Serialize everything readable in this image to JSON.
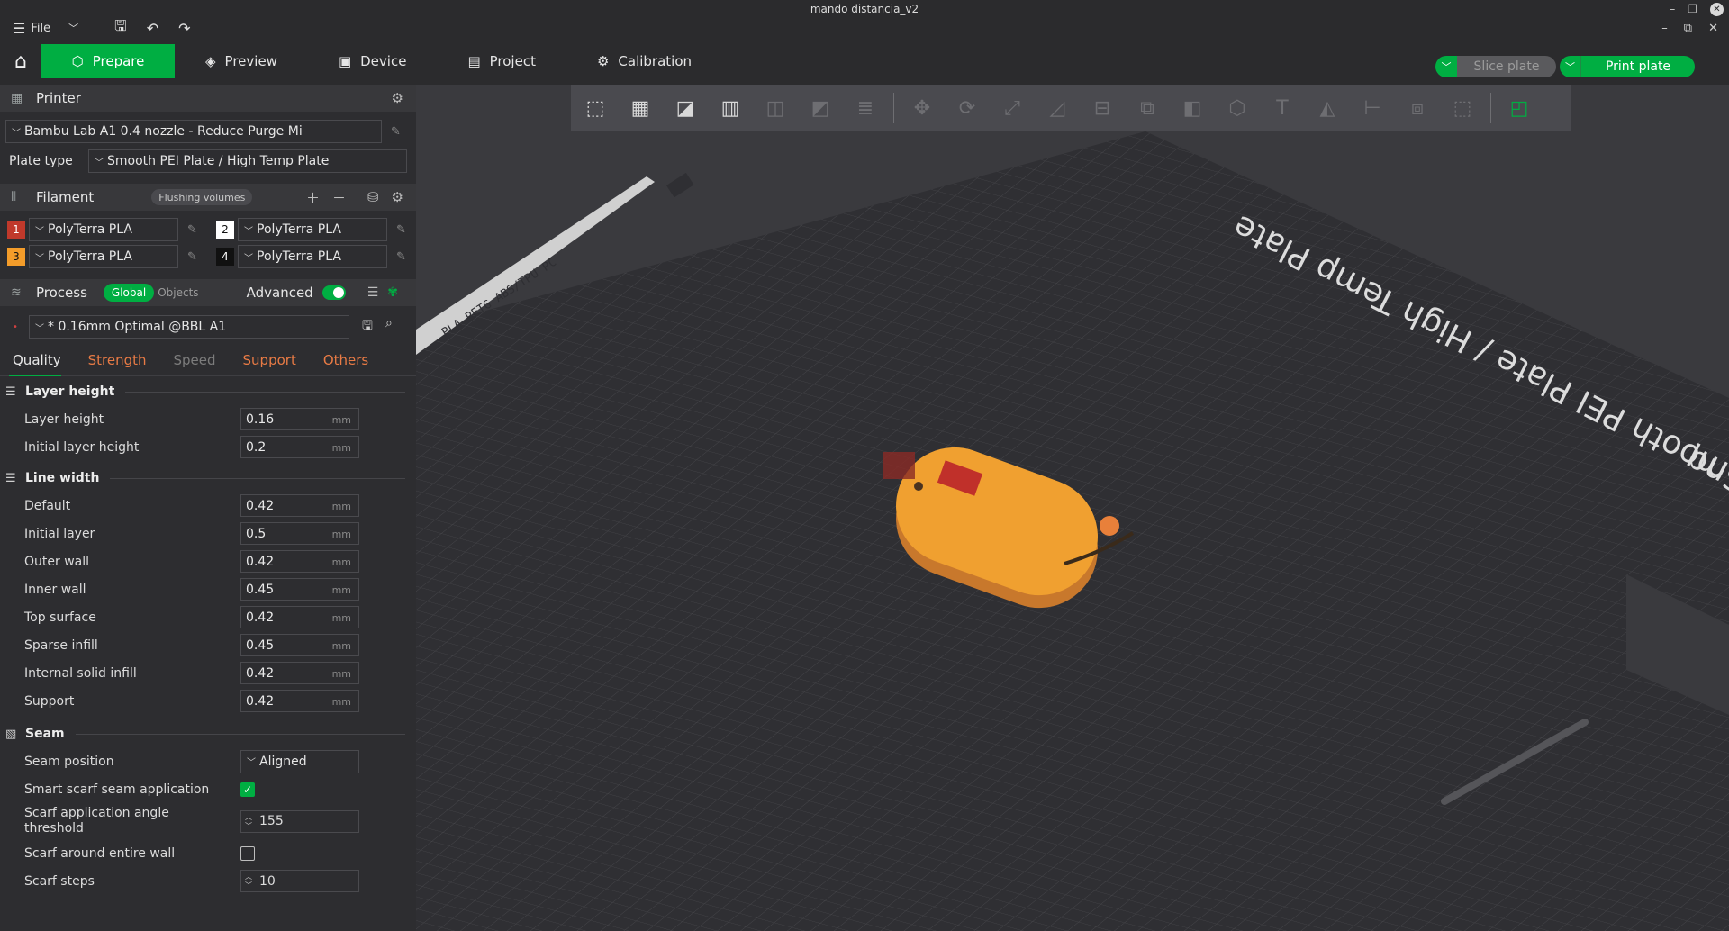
{
  "window": {
    "title": "mando distancia_v2"
  },
  "menu": {
    "file_label": "File"
  },
  "tabs": [
    {
      "label": "Prepare"
    },
    {
      "label": "Preview"
    },
    {
      "label": "Device"
    },
    {
      "label": "Project"
    },
    {
      "label": "Calibration"
    }
  ],
  "actions": {
    "slice_label": "Slice plate",
    "print_label": "Print plate"
  },
  "printer": {
    "section_title": "Printer",
    "preset": "Bambu Lab A1 0.4 nozzle - Reduce Purge Mi",
    "plate_type_label": "Plate type",
    "plate_type_value": "Smooth PEI Plate / High Temp Plate"
  },
  "filament": {
    "section_title": "Filament",
    "flushing_label": "Flushing volumes",
    "items": [
      {
        "num": "1",
        "name": "PolyTerra PLA",
        "color": "#c0392b"
      },
      {
        "num": "2",
        "name": "PolyTerra PLA",
        "color": "#ffffff"
      },
      {
        "num": "3",
        "name": "PolyTerra PLA",
        "color": "#f39c2a"
      },
      {
        "num": "4",
        "name": "PolyTerra PLA",
        "color": "#111111"
      }
    ]
  },
  "process": {
    "section_title": "Process",
    "global_label": "Global",
    "objects_label": "Objects",
    "advanced_label": "Advanced",
    "preset": "* 0.16mm Optimal @BBL A1",
    "subtabs": [
      "Quality",
      "Strength",
      "Speed",
      "Support",
      "Others"
    ]
  },
  "settings": {
    "layer_height_group": "Layer height",
    "layer_height_label": "Layer height",
    "layer_height_value": "0.16",
    "initial_layer_height_label": "Initial layer height",
    "initial_layer_height_value": "0.2",
    "line_width_group": "Line width",
    "lw_default_label": "Default",
    "lw_default_value": "0.42",
    "lw_initial_label": "Initial layer",
    "lw_initial_value": "0.5",
    "lw_outer_label": "Outer wall",
    "lw_outer_value": "0.42",
    "lw_inner_label": "Inner wall",
    "lw_inner_value": "0.45",
    "lw_top_label": "Top surface",
    "lw_top_value": "0.42",
    "lw_sparse_label": "Sparse infill",
    "lw_sparse_value": "0.45",
    "lw_internal_label": "Internal solid infill",
    "lw_internal_value": "0.42",
    "lw_support_label": "Support",
    "lw_support_value": "0.42",
    "seam_group": "Seam",
    "seam_position_label": "Seam position",
    "seam_position_value": "Aligned",
    "smart_scarf_label": "Smart scarf seam application",
    "scarf_angle_label_1": "Scarf application angle",
    "scarf_angle_label_2": "threshold",
    "scarf_angle_value": "155",
    "scarf_around_label": "Scarf around entire wall",
    "scarf_steps_label": "Scarf steps",
    "scarf_steps_value": "10",
    "unit": "mm"
  },
  "plate": {
    "big_label": "Smooth PEI Plate / High Temp Plate",
    "big_label_prefix": "nq",
    "small_label": "PLA PETG ABS/TPU PC"
  }
}
